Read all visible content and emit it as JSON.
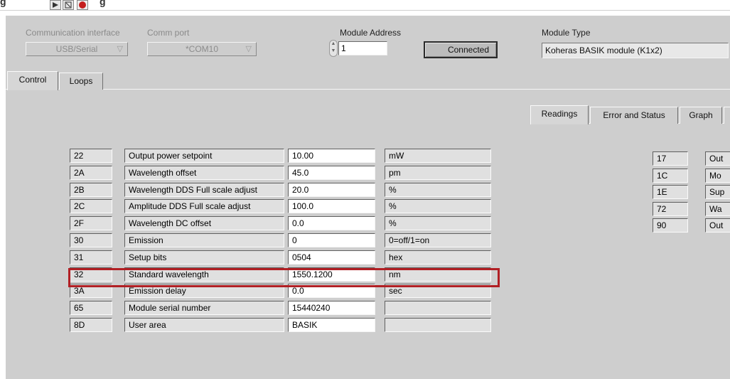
{
  "top": {
    "caption_left": "g",
    "caption_right": "g"
  },
  "comm": {
    "interface_label": "Communication interface",
    "interface_value": "USB/Serial",
    "port_label": "Comm port",
    "port_value": "*COM10",
    "module_address_label": "Module Address",
    "module_address_value": "1",
    "connected_label": "Connected",
    "module_type_label": "Module Type",
    "module_type_value": "Koheras BASIK module (K1x2)"
  },
  "tabs": {
    "main": [
      "Control",
      "Loops"
    ],
    "right": [
      "Readings",
      "Error and Status",
      "Graph"
    ]
  },
  "control_rows": [
    {
      "reg": "22",
      "name": "Output power setpoint",
      "value": "10.00",
      "unit": "mW"
    },
    {
      "reg": "2A",
      "name": "Wavelength offset",
      "value": "45.0",
      "unit": "pm"
    },
    {
      "reg": "2B",
      "name": "Wavelength DDS Full scale adjust",
      "value": "20.0",
      "unit": "%"
    },
    {
      "reg": "2C",
      "name": "Amplitude DDS Full scale adjust",
      "value": "100.0",
      "unit": "%"
    },
    {
      "reg": "2F",
      "name": "Wavelength DC offset",
      "value": "0.0",
      "unit": "%"
    },
    {
      "reg": "30",
      "name": "Emission",
      "value": "0",
      "unit": "0=off/1=on"
    },
    {
      "reg": "31",
      "name": "Setup bits",
      "value": "0504",
      "unit": "hex"
    },
    {
      "reg": "32",
      "name": "Standard wavelength",
      "value": "1550.1200",
      "unit": "nm"
    },
    {
      "reg": "3A",
      "name": "Emission delay",
      "value": "0.0",
      "unit": "sec"
    },
    {
      "reg": "65",
      "name": "Module serial number",
      "value": "15440240",
      "unit": ""
    },
    {
      "reg": "8D",
      "name": "User area",
      "value": "BASIK",
      "unit": ""
    }
  ],
  "readings_rows": [
    {
      "reg": "17",
      "name": "Out"
    },
    {
      "reg": "1C",
      "name": "Mo"
    },
    {
      "reg": "1E",
      "name": "Sup"
    },
    {
      "reg": "72",
      "name": "Wa"
    },
    {
      "reg": "90",
      "name": "Out"
    }
  ],
  "colors": {
    "panel": "#cecece",
    "highlight": "#b11f24"
  },
  "icons": [
    "run-arrow-icon",
    "abort-icon",
    "stop-icon"
  ]
}
